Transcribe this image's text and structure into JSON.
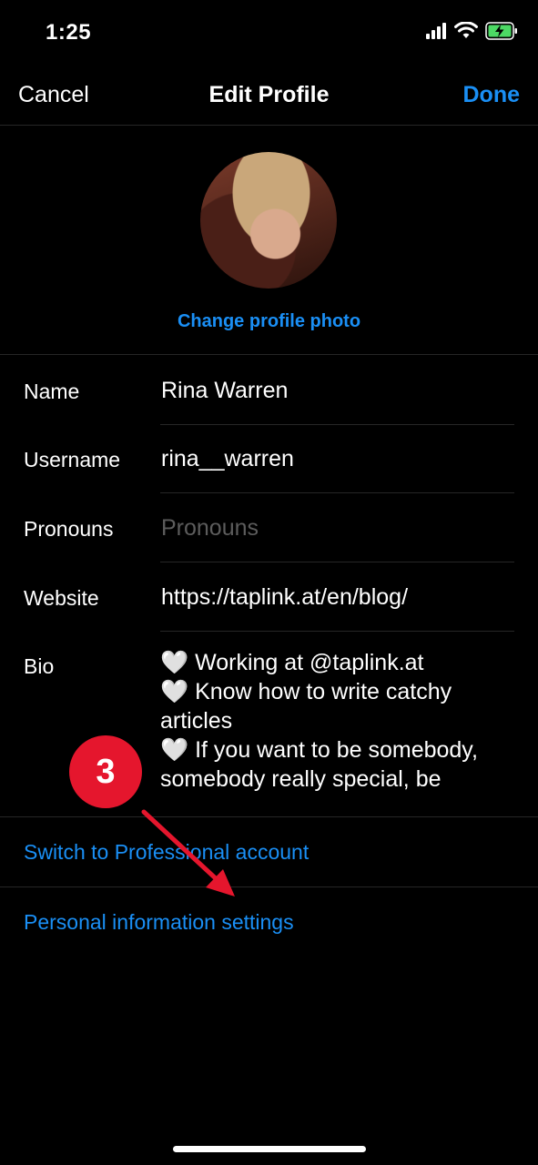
{
  "status_bar": {
    "time": "1:25",
    "battery_color": "#4cd964"
  },
  "nav": {
    "cancel": "Cancel",
    "title": "Edit Profile",
    "done": "Done"
  },
  "profile": {
    "change_photo": "Change profile photo"
  },
  "fields": {
    "name": {
      "label": "Name",
      "value": "Rina Warren"
    },
    "username": {
      "label": "Username",
      "value": "rina__warren"
    },
    "pronouns": {
      "label": "Pronouns",
      "placeholder": "Pronouns"
    },
    "website": {
      "label": "Website",
      "value": "https://taplink.at/en/blog/"
    },
    "bio": {
      "label": "Bio",
      "value": "🤍 Working at @taplink.at\n🤍 Know how to write catchy articles\n🤍 If you want to be somebody, somebody really special, be"
    }
  },
  "links": {
    "professional": "Switch to Professional account",
    "personal_info": "Personal information settings"
  },
  "annotation": {
    "step": "3",
    "color": "#e5162d"
  },
  "colors": {
    "accent": "#1a8ff5",
    "background": "#000000",
    "divider": "#262626"
  }
}
